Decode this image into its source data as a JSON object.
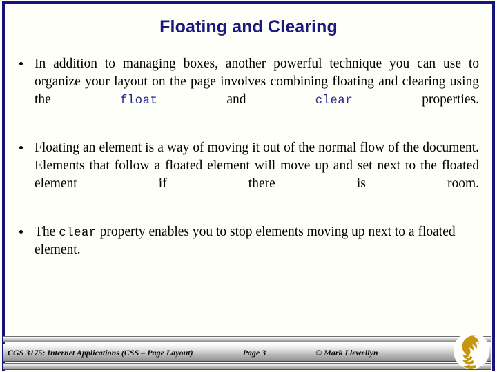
{
  "slide": {
    "title": "Floating and Clearing",
    "accent_color": "#19197f",
    "border_color": "#14147a",
    "background_color": "#fffffa",
    "code_blue": "#2b2b8c",
    "logo_gold": "#c8960c"
  },
  "bullets": [
    {
      "segments": [
        {
          "type": "text",
          "value": "In addition to managing boxes, another powerful technique you can use to organize your layout on the page involves combining floating and clearing using the "
        },
        {
          "type": "code-blue",
          "value": "float"
        },
        {
          "type": "text",
          "value": " and "
        },
        {
          "type": "code-blue",
          "value": "clear"
        },
        {
          "type": "text",
          "value": " properties."
        }
      ]
    },
    {
      "segments": [
        {
          "type": "text",
          "value": "Floating an element is a way of moving it out of the normal flow of the document.  Elements that follow a floated element will move up and set next to the floated element if there is room."
        }
      ]
    },
    {
      "segments": [
        {
          "type": "text",
          "value": "The "
        },
        {
          "type": "code-black",
          "value": "clear"
        },
        {
          "type": "text",
          "value": " property enables you to stop elements moving up next to a floated element."
        }
      ]
    }
  ],
  "footer": {
    "course": "CGS 3175: Internet Applications (CSS – Page Layout)",
    "page": "Page 3",
    "copyright": "© Mark Llewellyn",
    "logo_name": "ucf-pegasus-logo"
  }
}
